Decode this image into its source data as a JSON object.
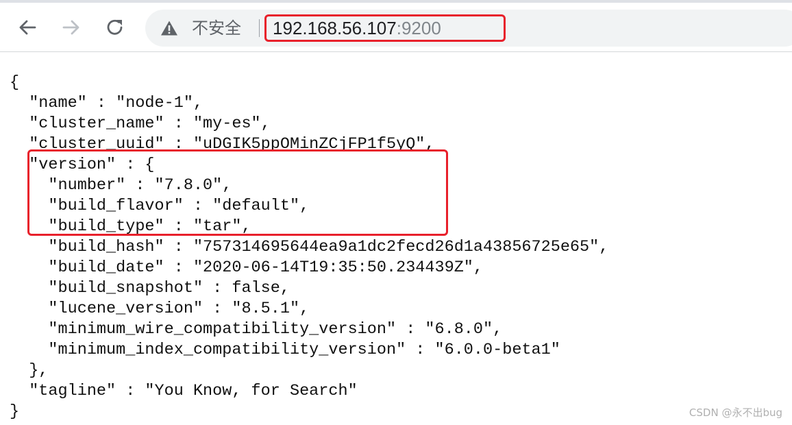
{
  "browser": {
    "security_label": "不安全",
    "url_host": "192.168.56.107",
    "url_port": ":9200",
    "icons": {
      "back": "arrow-left-icon",
      "forward": "arrow-right-icon",
      "reload": "reload-icon",
      "security": "warning-triangle-icon"
    },
    "colors": {
      "highlight": "#e8202b",
      "omnibox_bg": "#f1f3f4"
    }
  },
  "json_lines": [
    "{",
    "  \"name\" : \"node-1\",",
    "  \"cluster_name\" : \"my-es\",",
    "  \"cluster_uuid\" : \"uDGIK5ppOMinZCjFP1f5yQ\",",
    "  \"version\" : {",
    "    \"number\" : \"7.8.0\",",
    "    \"build_flavor\" : \"default\",",
    "    \"build_type\" : \"tar\",",
    "    \"build_hash\" : \"757314695644ea9a1dc2fecd26d1a43856725e65\",",
    "    \"build_date\" : \"2020-06-14T19:35:50.234439Z\",",
    "    \"build_snapshot\" : false,",
    "    \"lucene_version\" : \"8.5.1\",",
    "    \"minimum_wire_compatibility_version\" : \"6.8.0\",",
    "    \"minimum_index_compatibility_version\" : \"6.0.0-beta1\"",
    "  },",
    "  \"tagline\" : \"You Know, for Search\"",
    "}"
  ],
  "watermark": "CSDN @永不出bug"
}
